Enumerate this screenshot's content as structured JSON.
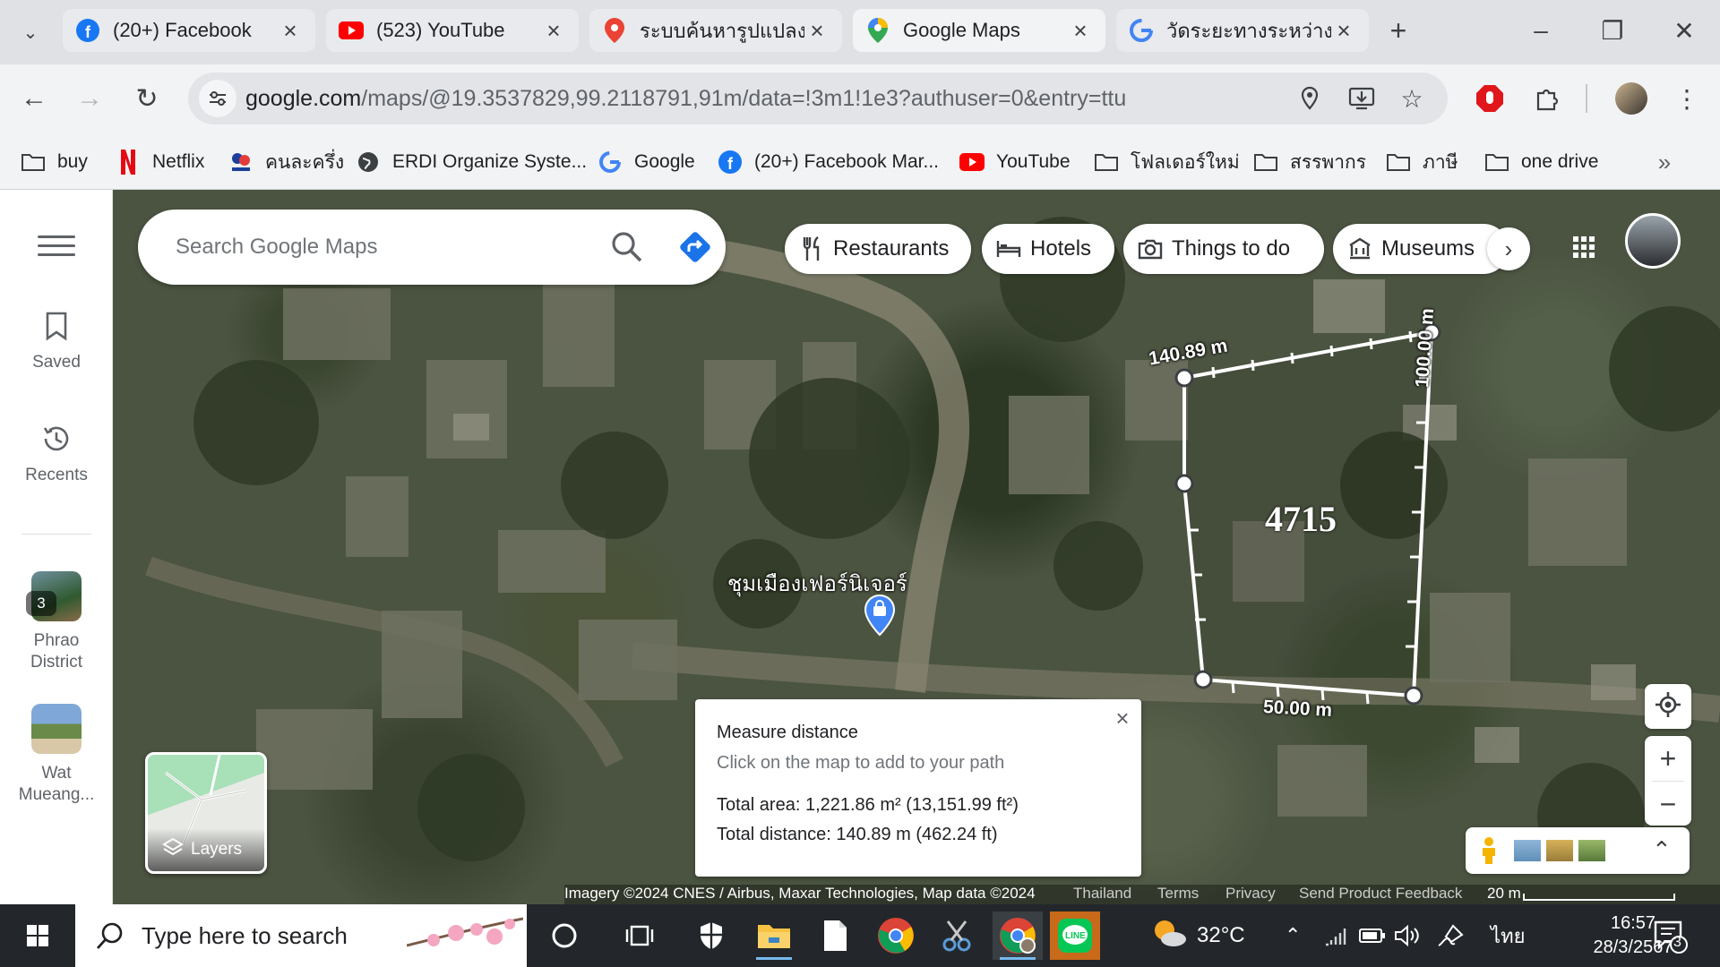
{
  "browser": {
    "tabs": [
      {
        "title": "(20+) Facebook",
        "icon": "facebook-icon",
        "active": false
      },
      {
        "title": "(523) YouTube",
        "icon": "youtube-icon",
        "active": false
      },
      {
        "title": "ระบบค้นหารูปแปลงที่ดิ",
        "icon": "map-pin-icon",
        "active": false
      },
      {
        "title": "Google Maps",
        "icon": "google-maps-icon",
        "active": true
      },
      {
        "title": "วัดระยะทางระหว่างจุด",
        "icon": "google-icon",
        "active": false
      }
    ],
    "url_host": "google.com",
    "url_path": "/maps/@19.3537829,99.2118791,91m/data=!3m1!1e3?authuser=0&entry=ttu",
    "bookmarks": [
      {
        "label": "buy",
        "icon": "folder-icon"
      },
      {
        "label": "Netflix",
        "icon": "netflix-icon"
      },
      {
        "label": "คนละครึ่ง",
        "icon": "khon-la-khrueng-icon"
      },
      {
        "label": "ERDI Organize Syste...",
        "icon": "globe-icon"
      },
      {
        "label": "Google",
        "icon": "google-icon"
      },
      {
        "label": "(20+) Facebook Mar...",
        "icon": "facebook-icon"
      },
      {
        "label": "YouTube",
        "icon": "youtube-icon"
      },
      {
        "label": "โฟลเดอร์ใหม่",
        "icon": "folder-icon"
      },
      {
        "label": "สรรพากร",
        "icon": "folder-icon"
      },
      {
        "label": "ภาษี",
        "icon": "folder-icon"
      },
      {
        "label": "one drive",
        "icon": "folder-icon"
      }
    ]
  },
  "maps": {
    "search_placeholder": "Search Google Maps",
    "rail": {
      "saved": "Saved",
      "recents": "Recents",
      "recent_places": [
        {
          "label_line1": "Phrao",
          "label_line2": "District",
          "badge": "3"
        },
        {
          "label_line1": "Wat",
          "label_line2": "Mueang..."
        }
      ]
    },
    "chips": [
      {
        "label": "Restaurants",
        "icon": "fork-knife-icon"
      },
      {
        "label": "Hotels",
        "icon": "bed-icon"
      },
      {
        "label": "Things to do",
        "icon": "camera-icon"
      },
      {
        "label": "Museums",
        "icon": "museum-icon"
      }
    ],
    "place_label": "ชุมเมืองเฟอร์นิเจอร์",
    "measurement": {
      "edge_top": "140.89 m",
      "edge_right": "100.00 m",
      "edge_bottom": "50.00 m",
      "plot_number": "4715"
    },
    "measure_card": {
      "title": "Measure distance",
      "subtitle": "Click on the map to add to your path",
      "total_area": "Total area: 1,221.86 m² (13,151.99 ft²)",
      "total_distance": "Total distance: 140.89 m (462.24 ft)"
    },
    "layers_label": "Layers",
    "attribution": {
      "imagery": "Imagery ©2024 CNES / Airbus, Maxar Technologies, Map data ©2024",
      "country": "Thailand",
      "terms": "Terms",
      "privacy": "Privacy",
      "feedback": "Send Product Feedback",
      "scale": "20 m"
    }
  },
  "taskbar": {
    "search_placeholder": "Type here to search",
    "weather": "32°C",
    "language": "ไทย",
    "time": "16:57",
    "date": "28/3/2567",
    "notification_count": "3"
  },
  "colors": {
    "maps_blue": "#1a73e8",
    "measure_line": "#ffffff",
    "pin_blue": "#4285f4",
    "taskbar": "#23272b"
  }
}
